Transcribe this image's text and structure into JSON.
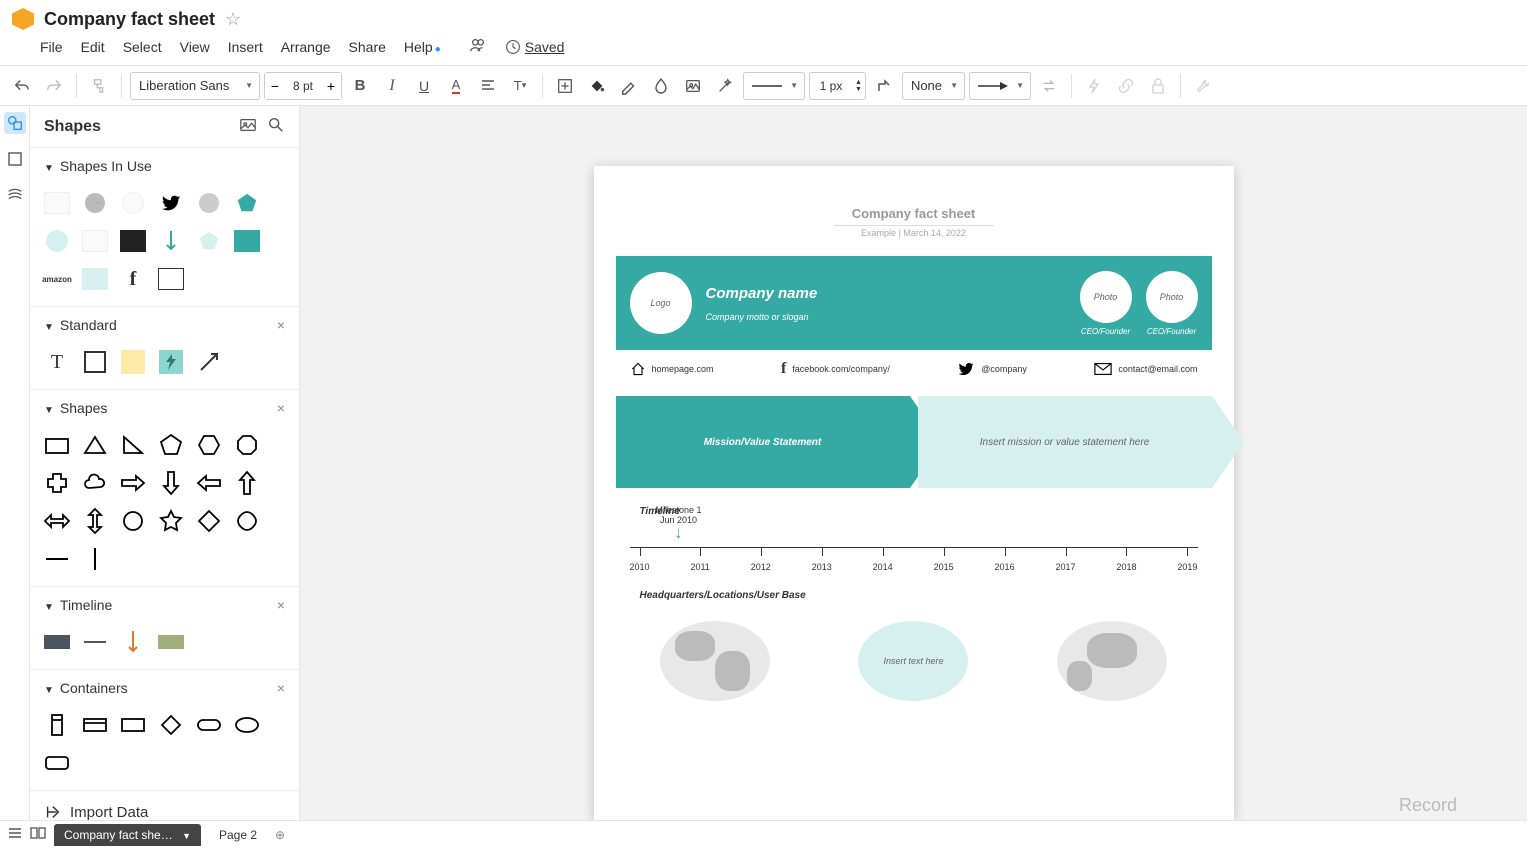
{
  "doc": {
    "title": "Company fact sheet"
  },
  "menu": {
    "file": "File",
    "edit": "Edit",
    "select": "Select",
    "view": "View",
    "insert": "Insert",
    "arrange": "Arrange",
    "share": "Share",
    "help": "Help",
    "saved": "Saved"
  },
  "toolbar": {
    "font": "Liberation Sans",
    "font_size": "8 pt",
    "line_width": "1 px",
    "arrow_style": "None"
  },
  "sidebar": {
    "title": "Shapes",
    "sections": {
      "in_use": "Shapes In Use",
      "standard": "Standard",
      "shapes": "Shapes",
      "timeline": "Timeline",
      "containers": "Containers"
    },
    "import": "Import Data"
  },
  "canvas": {
    "header": {
      "title": "Company fact sheet",
      "subtitle": "Example  |  March 14, 2022"
    },
    "band": {
      "logo": "Logo",
      "company": "Company name",
      "motto": "Company motto or slogan",
      "photo": "Photo",
      "role": "CEO/Founder"
    },
    "contacts": {
      "home": "homepage.com",
      "fb": "facebook.com/company/",
      "tw": "@company",
      "mail": "contact@email.com"
    },
    "arrows": {
      "mission": "Mission/Value Statement",
      "placeholder": "Insert mission or value statement here"
    },
    "timeline": {
      "title": "Timeline",
      "milestone_name": "Milestone 1",
      "milestone_date": "Jun 2010",
      "years": [
        "2010",
        "2011",
        "2012",
        "2013",
        "2014",
        "2015",
        "2016",
        "2017",
        "2018",
        "2019"
      ]
    },
    "hq": {
      "title": "Headquarters/Locations/User Base",
      "insert": "Insert text here"
    }
  },
  "tabs": {
    "active": "Company fact she…",
    "second": "Page 2"
  },
  "record": "Record"
}
